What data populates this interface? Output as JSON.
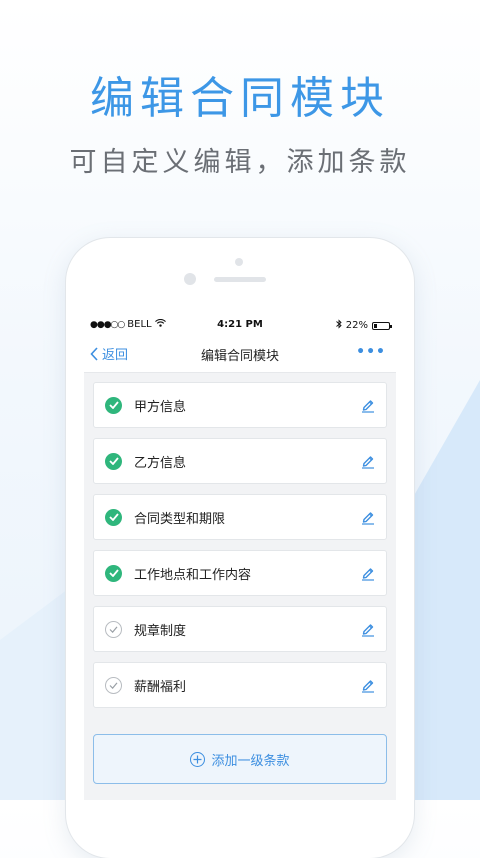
{
  "headline": "编辑合同模块",
  "subline": "可自定义编辑，添加条款",
  "status_bar": {
    "signal": "●●●○○",
    "carrier": "BELL",
    "time": "4:21 PM",
    "battery": "22%"
  },
  "nav": {
    "back_label": "返回",
    "title": "编辑合同模块",
    "more_label": "•••"
  },
  "items": [
    {
      "label": "甲方信息",
      "checked": true
    },
    {
      "label": "乙方信息",
      "checked": true
    },
    {
      "label": "合同类型和期限",
      "checked": true
    },
    {
      "label": "工作地点和工作内容",
      "checked": true
    },
    {
      "label": "规章制度",
      "checked": false
    },
    {
      "label": "薪酬福利",
      "checked": false
    }
  ],
  "add_button_label": "添加一级条款",
  "colors": {
    "accent": "#3d97e6",
    "check_green": "#2fb67c",
    "link_blue": "#3d8fe0"
  },
  "icons": {
    "back": "chevron-left-icon",
    "more": "more-dots-icon",
    "check": "check-circle-icon",
    "edit": "pencil-icon",
    "add": "plus-circle-icon",
    "wifi": "wifi-icon",
    "bluetooth": "bluetooth-icon",
    "battery": "battery-icon"
  }
}
